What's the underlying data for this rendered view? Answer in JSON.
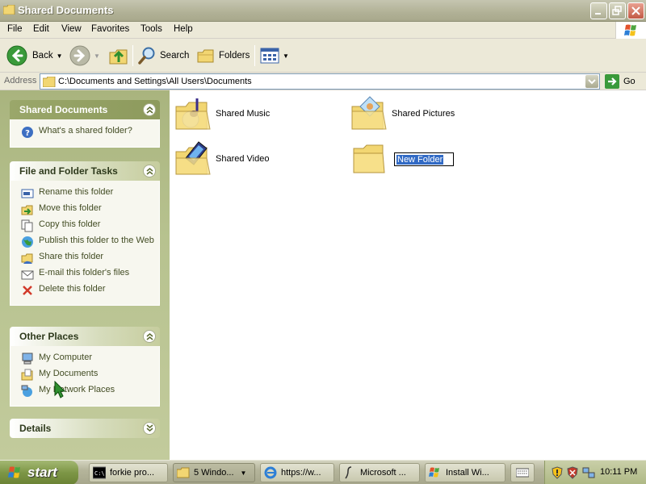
{
  "window": {
    "title": "Shared Documents"
  },
  "menu": {
    "items": [
      "File",
      "Edit",
      "View",
      "Favorites",
      "Tools",
      "Help"
    ]
  },
  "toolbar": {
    "back_label": "Back",
    "search_label": "Search",
    "folders_label": "Folders"
  },
  "address": {
    "label": "Address",
    "value": "C:\\Documents and Settings\\All Users\\Documents",
    "go_label": "Go"
  },
  "sidebar": {
    "shared_docs": {
      "title": "Shared Documents",
      "items": [
        {
          "label": "What's a shared folder?",
          "icon": "help-icon"
        }
      ]
    },
    "tasks": {
      "title": "File and Folder Tasks",
      "items": [
        {
          "label": "Rename this folder",
          "icon": "rename-icon"
        },
        {
          "label": "Move this folder",
          "icon": "move-icon"
        },
        {
          "label": "Copy this folder",
          "icon": "copy-icon"
        },
        {
          "label": "Publish this folder to the Web",
          "icon": "globe-icon"
        },
        {
          "label": "Share this folder",
          "icon": "share-icon"
        },
        {
          "label": "E-mail this folder's files",
          "icon": "email-icon"
        },
        {
          "label": "Delete this folder",
          "icon": "delete-icon"
        }
      ]
    },
    "other_places": {
      "title": "Other Places",
      "items": [
        {
          "label": "My Computer",
          "icon": "computer-icon"
        },
        {
          "label": "My Documents",
          "icon": "documents-icon"
        },
        {
          "label": "My Network Places",
          "icon": "network-icon"
        }
      ]
    },
    "details": {
      "title": "Details"
    }
  },
  "content": {
    "folders": [
      {
        "label": "Shared Music",
        "icon": "music-folder-icon"
      },
      {
        "label": "Shared Pictures",
        "icon": "pictures-folder-icon"
      },
      {
        "label": "Shared Video",
        "icon": "video-folder-icon"
      }
    ],
    "new_folder": {
      "label": "New Folder",
      "icon": "folder-icon"
    }
  },
  "taskbar": {
    "start_label": "start",
    "tasks": [
      {
        "label": "forkie pro...",
        "icon": "cmd-icon"
      },
      {
        "label": "5 Windo...",
        "icon": "folder-icon"
      },
      {
        "label": "https://w...",
        "icon": "ie-icon"
      },
      {
        "label": "Microsoft ...",
        "icon": "script-icon"
      },
      {
        "label": "Install Wi...",
        "icon": "installer-icon"
      }
    ],
    "clock": "10:11 PM"
  },
  "colors": {
    "titlebar": "#b1b196",
    "sidebar": "#b7c28f",
    "selection": "#316ac5",
    "start_button": "#7d9646"
  }
}
